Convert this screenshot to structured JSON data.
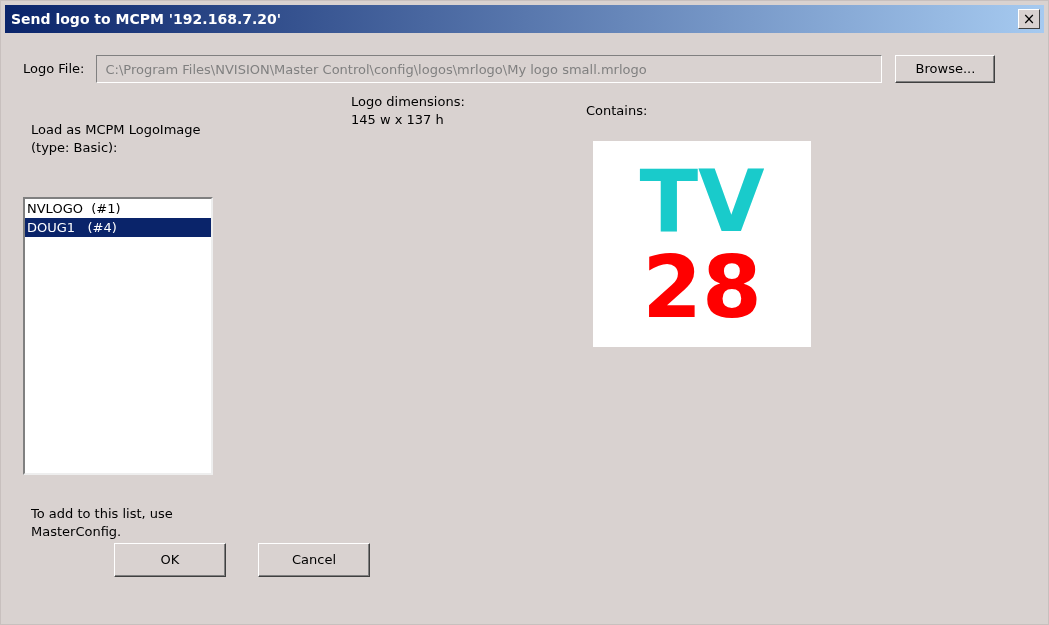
{
  "window": {
    "title": "Send logo to MCPM '192.168.7.20'",
    "close_label": "×"
  },
  "logo_file": {
    "label": "Logo File:",
    "value": "C:\\Program Files\\NVISION\\Master Control\\config\\logos\\mrlogo\\My logo small.mrlogo",
    "disabled": true,
    "browse_button": "Browse..."
  },
  "load_as": {
    "label": "Load as MCPM LogoImage (type: Basic):",
    "items": [
      {
        "text": "NVLOGO  (#1)",
        "selected": false
      },
      {
        "text": "DOUG1   (#4)",
        "selected": true
      }
    ],
    "hint": "To add to this list, use MasterConfig."
  },
  "dimensions": {
    "label": "Logo dimensions:",
    "value": "145 w x 137 h"
  },
  "contains": {
    "label": "Contains:",
    "logo_preview": {
      "line_1": "TV",
      "line_2": "28"
    }
  },
  "buttons": [
    "OK",
    "Cancel"
  ]
}
